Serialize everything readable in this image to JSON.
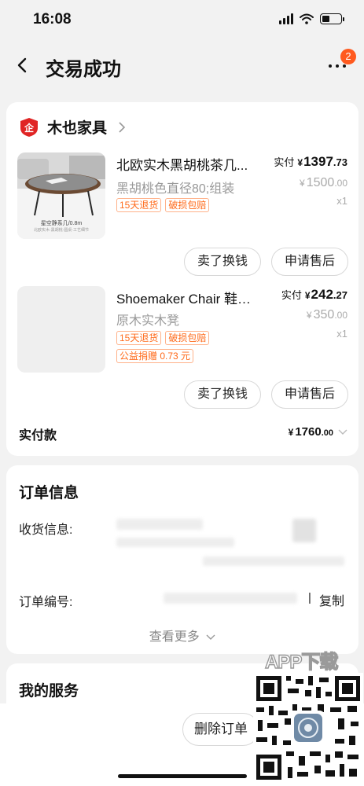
{
  "status": {
    "time": "16:08"
  },
  "nav": {
    "title": "交易成功",
    "badge": "2"
  },
  "store": {
    "name": "木也家具",
    "items": [
      {
        "name": "北欧实木黑胡桃茶几...",
        "spec": "黑胡桃色直径80;组装",
        "tags": [
          "15天退货",
          "破损包赔"
        ],
        "paid_label": "实付",
        "paid_yen": "¥",
        "paid_int": "1397",
        "paid_dec": ".73",
        "orig_yen": "¥",
        "orig_int": "1500",
        "orig_dec": ".00",
        "qty": "x1",
        "thumb_caption": "星空静系几/0.8m",
        "thumb_caption2": "北欧实木·黑胡桃·圆桌·工艺细节",
        "btn_sell": "卖了换钱",
        "btn_aftersale": "申请售后"
      },
      {
        "name": "Shoemaker Chair 鞋匠...",
        "spec": "原木实木凳",
        "tags": [
          "15天退货",
          "破损包赔"
        ],
        "charity": "公益捐赠 0.73 元",
        "paid_label": "实付",
        "paid_yen": "¥",
        "paid_int": "242",
        "paid_dec": ".27",
        "orig_yen": "¥",
        "orig_int": "350",
        "orig_dec": ".00",
        "qty": "x1",
        "btn_sell": "卖了换钱",
        "btn_aftersale": "申请售后"
      }
    ],
    "total_label": "实付款",
    "total_yen": "¥",
    "total_int": "1760",
    "total_dec": ".00"
  },
  "order_info": {
    "title": "订单信息",
    "receiver_label": "收货信息:",
    "order_no_label": "订单编号:",
    "separator": "|",
    "copy": "复制",
    "see_more": "查看更多"
  },
  "services": {
    "title": "我的服务"
  },
  "bottom": {
    "delete": "删除订单"
  },
  "watermark": {
    "text": "APP下载"
  },
  "colors": {
    "accent": "#ff6a1a",
    "brand_red": "#e02424",
    "badge": "#ff5a1f"
  }
}
